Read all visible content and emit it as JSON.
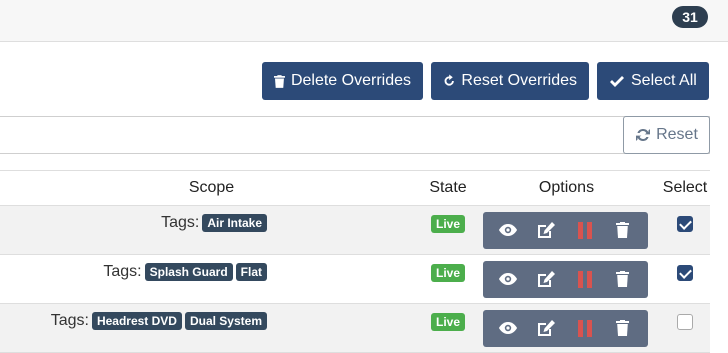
{
  "header": {
    "count": "31"
  },
  "toolbar": {
    "delete_label": "Delete Overrides",
    "reset_overrides_label": "Reset Overrides",
    "select_all_label": "Select All"
  },
  "filter": {
    "reset_label": "Reset"
  },
  "table": {
    "columns": {
      "scope": "Scope",
      "state": "State",
      "options": "Options",
      "select": "Select"
    },
    "rows": [
      {
        "scope_prefix": "Tags:",
        "tags": [
          "Air Intake"
        ],
        "state": "Live",
        "selected": true
      },
      {
        "scope_prefix": "Tags:",
        "tags": [
          "Splash Guard",
          "Flat"
        ],
        "state": "Live",
        "selected": true
      },
      {
        "scope_prefix": "Tags:",
        "tags": [
          "Headrest DVD",
          "Dual System"
        ],
        "state": "Live",
        "selected": false
      }
    ]
  },
  "colors": {
    "primary": "#2c4a78",
    "live": "#4cae4c",
    "tag": "#34495e",
    "pause": "#d9534f",
    "options_bg": "#5f6c82"
  },
  "icons": [
    "trash-icon",
    "redo-icon",
    "check-icon",
    "refresh-icon",
    "eye-icon",
    "edit-icon",
    "pause-icon"
  ]
}
